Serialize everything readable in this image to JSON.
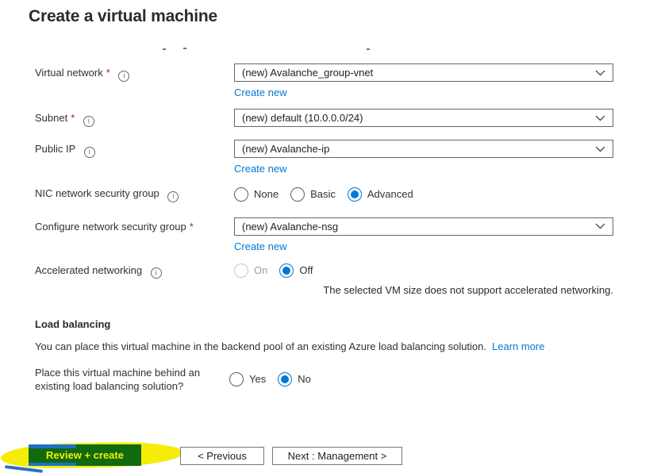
{
  "page": {
    "title": "Create a virtual machine"
  },
  "ui": {
    "required_marker": "*",
    "info_glyph": "i"
  },
  "fields": {
    "virtual_network": {
      "label": "Virtual network",
      "required": true,
      "value": "(new) Avalanche_group-vnet",
      "create_new_label": "Create new"
    },
    "subnet": {
      "label": "Subnet",
      "required": true,
      "value": "(new) default (10.0.0.0/24)"
    },
    "public_ip": {
      "label": "Public IP",
      "required": false,
      "value": "(new) Avalanche-ip",
      "create_new_label": "Create new"
    },
    "nic_nsg": {
      "label": "NIC network security group",
      "options": [
        "None",
        "Basic",
        "Advanced"
      ],
      "selected": "Advanced"
    },
    "configure_nsg": {
      "label": "Configure network security group",
      "required": true,
      "value": "(new) Avalanche-nsg",
      "create_new_label": "Create new"
    },
    "accelerated_networking": {
      "label": "Accelerated networking",
      "options": [
        "On",
        "Off"
      ],
      "selected": "Off",
      "disabled_options": [
        "On"
      ],
      "note": "The selected VM size does not support accelerated networking."
    }
  },
  "load_balancing": {
    "heading": "Load balancing",
    "description": "You can place this virtual machine in the backend pool of an existing Azure load balancing solution.",
    "learn_more_label": "Learn more",
    "question": {
      "label": "Place this virtual machine behind an existing load balancing solution?",
      "options": [
        "Yes",
        "No"
      ],
      "selected": "No"
    }
  },
  "footer": {
    "review_create_label": "Review + create",
    "previous_label": "< Previous",
    "next_label": "Next : Management >"
  },
  "colors": {
    "link": "#0078d4",
    "radio_selected": "#0078d4",
    "required_asterisk": "#a4262c",
    "review_button_blue": "#1e72c4",
    "marker_yellow": "#f6ec08",
    "marker_green_overlap": "#106a10"
  }
}
